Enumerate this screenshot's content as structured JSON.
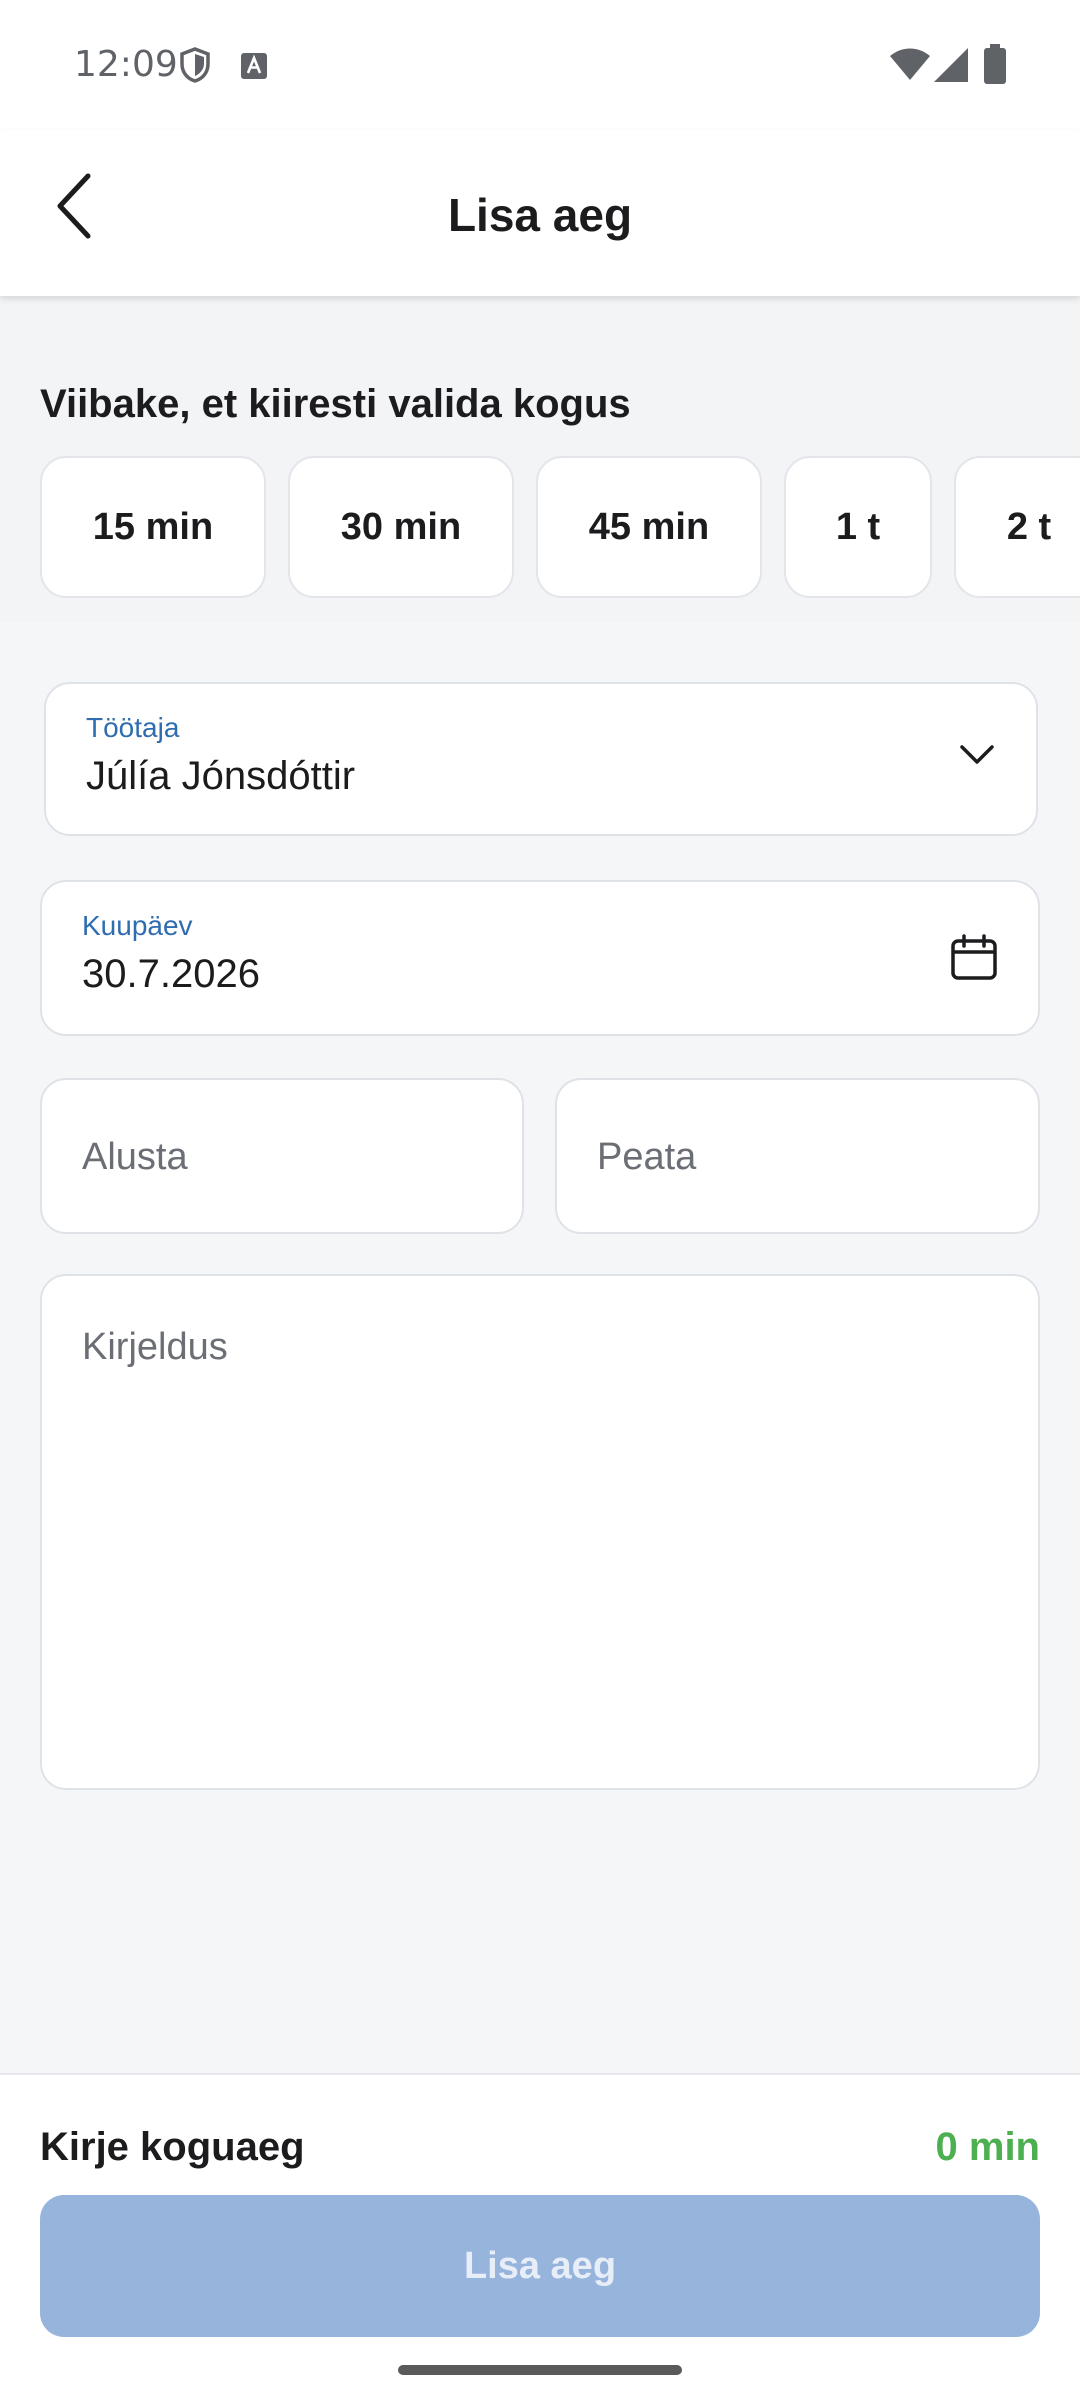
{
  "status": {
    "time": "12:09"
  },
  "header": {
    "title": "Lisa aeg"
  },
  "quick": {
    "label": "Viibake, et kiiresti valida kogus",
    "chips": [
      "15 min",
      "30 min",
      "45 min",
      "1 t",
      "2 t"
    ]
  },
  "form": {
    "employee": {
      "label": "Töötaja",
      "value": "Júlía Jónsdóttir"
    },
    "date": {
      "label": "Kuupäev",
      "value": "30.7.2026"
    },
    "start": {
      "placeholder": "Alusta"
    },
    "stop": {
      "placeholder": "Peata"
    },
    "description": {
      "placeholder": "Kirjeldus"
    }
  },
  "footer": {
    "total_label": "Kirje koguaeg",
    "total_value": "0 min",
    "submit_label": "Lisa aeg"
  },
  "colors": {
    "accent": "#2f6cb0",
    "total": "#4caf50",
    "button_disabled": "#97b4dc"
  }
}
